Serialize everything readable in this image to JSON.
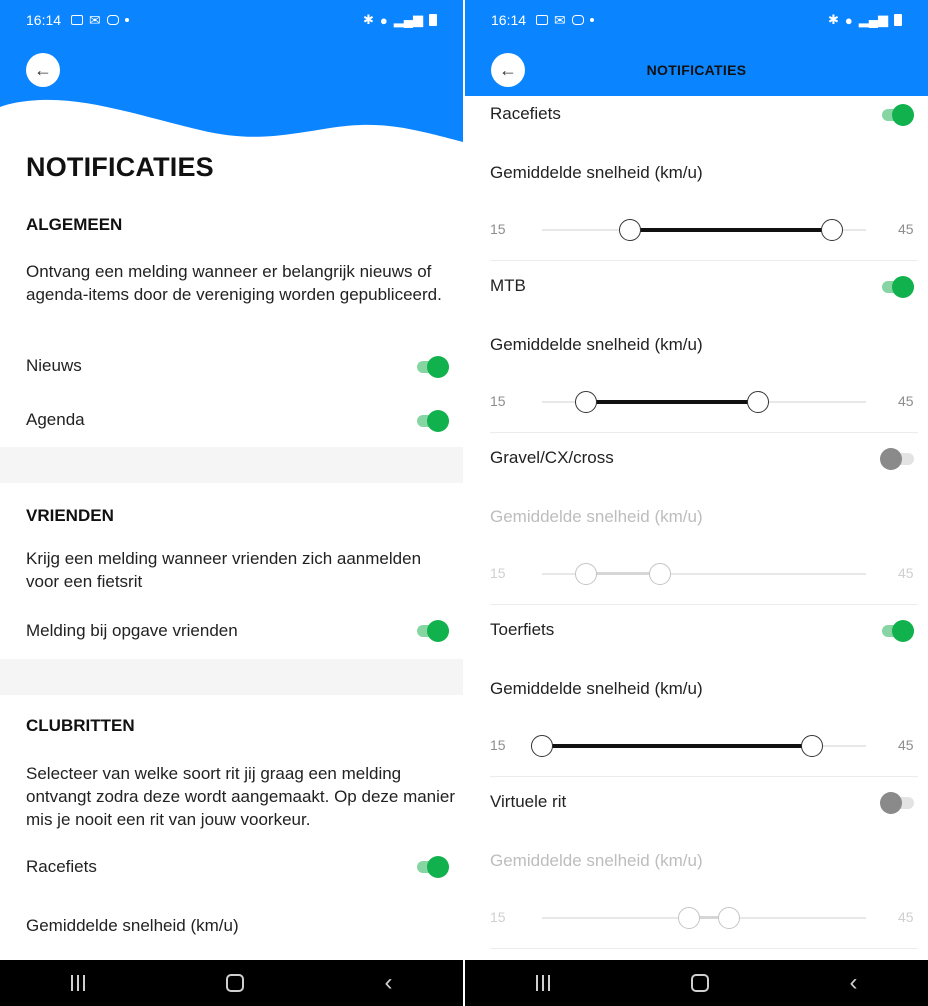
{
  "status": {
    "time": "16:14"
  },
  "left": {
    "title": "NOTIFICATIES",
    "algemeen": {
      "title": "ALGEMEEN",
      "desc": "Ontvang een melding wanneer er belangrijk nieuws of agenda-items door de vereniging worden gepubliceerd.",
      "items": [
        {
          "label": "Nieuws",
          "on": true
        },
        {
          "label": "Agenda",
          "on": true
        }
      ]
    },
    "vrienden": {
      "title": "VRIENDEN",
      "desc": "Krijg een melding wanneer vrienden zich aanmelden voor een fietsrit",
      "item": {
        "label": "Melding bij opgave vrienden",
        "on": true
      }
    },
    "clubritten": {
      "title": "CLUBRITTEN",
      "desc": "Selecteer van welke soort rit jij graag een melding ontvangt zodra deze wordt aangemaakt. Op deze manier mis je nooit een rit van jouw voorkeur.",
      "item": {
        "label": "Racefiets",
        "on": true
      },
      "speed_label": "Gemiddelde snelheid (km/u)"
    }
  },
  "right": {
    "title": "NOTIFICATIES",
    "ride_types": [
      {
        "label": "Racefiets",
        "on": true,
        "speed_label": "Gemiddelde snelheid (km/u)",
        "min": "15",
        "max": "45",
        "low": 0.273,
        "high": 0.895
      },
      {
        "label": "MTB",
        "on": true,
        "speed_label": "Gemiddelde snelheid (km/u)",
        "min": "15",
        "max": "45",
        "low": 0.136,
        "high": 0.667
      },
      {
        "label": "Gravel/CX/cross",
        "on": false,
        "speed_label": "Gemiddelde snelheid (km/u)",
        "min": "15",
        "max": "45",
        "low": 0.136,
        "high": 0.364
      },
      {
        "label": "Toerfiets",
        "on": true,
        "speed_label": "Gemiddelde snelheid (km/u)",
        "min": "15",
        "max": "45",
        "low": 0.0,
        "high": 0.833
      },
      {
        "label": "Virtuele rit",
        "on": false,
        "speed_label": "Gemiddelde snelheid (km/u)",
        "min": "15",
        "max": "45",
        "low": 0.455,
        "high": 0.576
      }
    ]
  }
}
